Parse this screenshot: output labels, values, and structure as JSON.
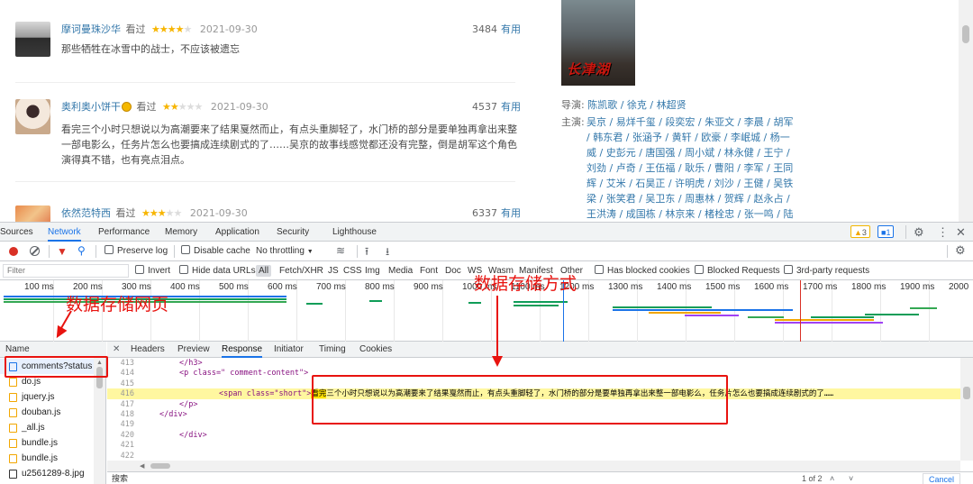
{
  "webpage": {
    "comments": [
      {
        "user": "摩诃曼珠沙华",
        "saw": "看过",
        "stars": 4,
        "date": "2021-09-30",
        "votes": "3484",
        "useful": "有用",
        "body": "那些牺牲在冰雪中的战士，不应该被遗忘"
      },
      {
        "user": "奥利奥小饼干",
        "saw": "看过",
        "stars": 2,
        "date": "2021-09-30",
        "votes": "4537",
        "useful": "有用",
        "body": "看完三个小时只想说以为高潮要来了结果戛然而止，有点头重脚轻了，水门桥的部分是要单独再拿出来整一部电影么，任务片怎么也要搞成连续剧式的了……吴京的故事线感觉都还没有完整，倒是胡军这个角色演得真不错，也有亮点泪点。"
      },
      {
        "user": "依然范特西",
        "saw": "看过",
        "stars": 3,
        "date": "2021-09-30",
        "votes": "6337",
        "useful": "有用",
        "body": ""
      }
    ],
    "sidebar": {
      "poster_title": "长津湖",
      "director_label": "导演:",
      "directors": "陈凯歌 / 徐克 / 林超贤",
      "cast_label": "主演:",
      "cast_lines": [
        "吴京 / 易烊千玺 / 段奕宏 / 朱亚文 / 李晨 / 胡军",
        "/ 韩东君 / 张涵予 / 黄轩 / 欧豪 / 李岷城 / 杨一",
        "威 / 史彭元 / 唐国强 / 周小斌 / 林永健 / 王宁 /",
        "刘劲 / 卢奇 / 王伍福 / 耿乐 / 曹阳 / 李军 / 王同",
        "辉 / 艾米 / 石昊正 / 许明虎 / 刘沙 / 王健 / 吴铁",
        "梁 / 张笑君 / 吴卫东 / 周惠林 / 贺辉 / 赵永占 /",
        "王洪涛 / 成国栋 / 林京来 / 楮栓忠 / 张一鸣 / 陆"
      ]
    }
  },
  "devtools": {
    "main_tabs": [
      "Sources",
      "Network",
      "Performance",
      "Memory",
      "Application",
      "Security",
      "Lighthouse"
    ],
    "active_tab": "Network",
    "warn_count": "3",
    "info_count": "1",
    "toolbar": {
      "preserve_log": "Preserve log",
      "disable_cache": "Disable cache",
      "throttling": "No throttling"
    },
    "filter": {
      "placeholder": "Filter",
      "invert": "Invert",
      "hide_data_urls": "Hide data URLs",
      "types": [
        "All",
        "Fetch/XHR",
        "JS",
        "CSS",
        "Img",
        "Media",
        "Font",
        "Doc",
        "WS",
        "Wasm",
        "Manifest",
        "Other"
      ],
      "has_blocked_cookies": "Has blocked cookies",
      "blocked_requests": "Blocked Requests",
      "third_party": "3rd-party requests"
    },
    "timeline_ticks": [
      "100 ms",
      "200 ms",
      "300 ms",
      "400 ms",
      "500 ms",
      "600 ms",
      "700 ms",
      "800 ms",
      "900 ms",
      "1000 ms",
      "1100 ms",
      "1200 ms",
      "1300 ms",
      "1400 ms",
      "1500 ms",
      "1600 ms",
      "1700 ms",
      "1800 ms",
      "1900 ms",
      "2000"
    ],
    "name_header": "Name",
    "requests": [
      {
        "name": "comments?status",
        "color": "#1a73e8"
      },
      {
        "name": "do.js",
        "color": "#f2a600"
      },
      {
        "name": "jquery.js",
        "color": "#f2a600"
      },
      {
        "name": "douban.js",
        "color": "#f2a600"
      },
      {
        "name": "_all.js",
        "color": "#f2a600"
      },
      {
        "name": "bundle.js",
        "color": "#f2a600"
      },
      {
        "name": "bundle.js",
        "color": "#f2a600"
      },
      {
        "name": "u2561289-8.jpg",
        "color": "#333333"
      }
    ],
    "detail_tabs": [
      "Headers",
      "Preview",
      "Response",
      "Initiator",
      "Timing",
      "Cookies"
    ],
    "active_detail_tab": "Response",
    "code_lines": [
      {
        "num": "413",
        "text": "</h3>"
      },
      {
        "num": "414",
        "text": "<p class=\" comment-content\">"
      },
      {
        "num": "415",
        "text": ""
      },
      {
        "num": "416",
        "tag": "<span class=\"short\">",
        "mark": "看完",
        "text": "三个小时只想说以为高潮要来了结果戛然而止，有点头重脚轻了，水门桥的部分是要单独再拿出来整一部电影么，任务片怎么也要搞成连续剧式的了……"
      },
      {
        "num": "417",
        "text": "</p>"
      },
      {
        "num": "418",
        "text": "</div>"
      },
      {
        "num": "419",
        "text": ""
      },
      {
        "num": "420",
        "text": "</div>"
      },
      {
        "num": "421",
        "text": ""
      },
      {
        "num": "422",
        "text": ""
      }
    ],
    "search": {
      "label": "搜索",
      "count": "1 of 2",
      "cancel": "Cancel"
    }
  },
  "annotations": {
    "left": "数据存储网页",
    "right": "数据存储方式",
    "color": "#e8130f"
  }
}
